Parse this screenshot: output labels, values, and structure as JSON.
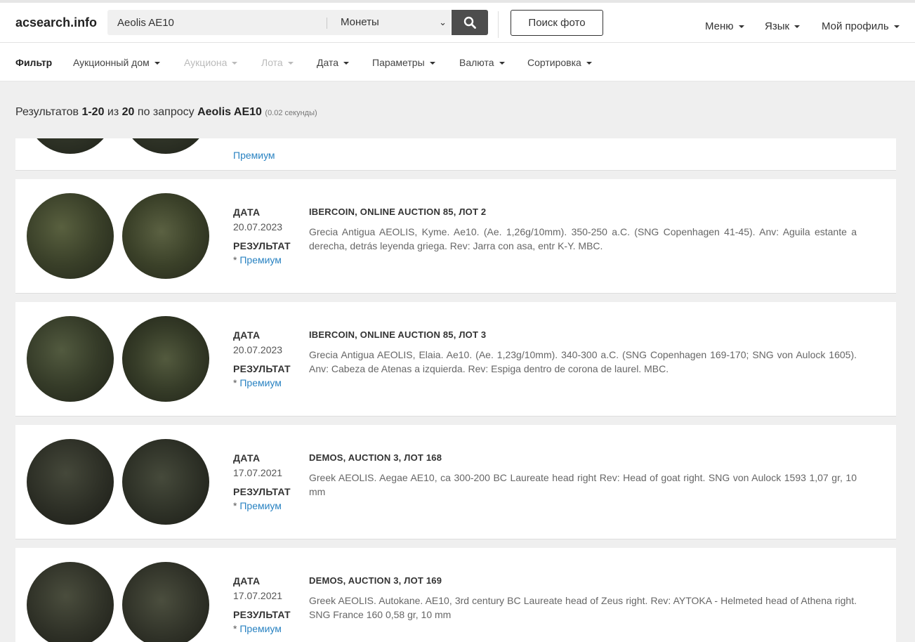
{
  "header": {
    "logo": "acsearch.info",
    "search_value": "Aeolis AE10",
    "category": "Монеты",
    "photo_search": "Поиск фото",
    "menu": "Меню",
    "language": "Язык",
    "profile": "Мой профиль"
  },
  "filters": {
    "title": "Фильтр",
    "auction_house": "Аукционный дом",
    "auctions": "Аукциона",
    "lots": "Лота",
    "date": "Дата",
    "params": "Параметры",
    "currency": "Валюта",
    "sort": "Сортировка"
  },
  "summary": {
    "prefix": "Результатов",
    "range": "1-20",
    "of": "из",
    "total": "20",
    "query_prefix": "по запросу",
    "query": "Aeolis AE10",
    "time": "(0.02 секунды)"
  },
  "labels": {
    "date": "ДАТА",
    "result": "РЕЗУЛЬТАТ",
    "premium_star": "*",
    "premium": "Премиум"
  },
  "results": [
    {
      "title": "IBERCOIN, ONLINE AUCTION 85, ЛОТ 2",
      "date": "20.07.2023",
      "description": "Grecia Antigua AEOLIS, Kyme. Ae10. (Ae. 1,26g/10mm). 350-250 a.C. (SNG Copenhagen 41-45). Anv: Aguila estante a derecha, detrás leyenda griega. Rev: Jarra con asa, entr K-Y. MBC."
    },
    {
      "title": "IBERCOIN, ONLINE AUCTION 85, ЛОТ 3",
      "date": "20.07.2023",
      "description": "Grecia Antigua AEOLIS, Elaia. Ae10. (Ae. 1,23g/10mm). 340-300 a.C. (SNG Copenhagen 169-170; SNG von Aulock 1605). Anv: Cabeza de Atenas a izquierda. Rev: Espiga dentro de corona de laurel. MBC."
    },
    {
      "title": "DEMOS, AUCTION 3, ЛОТ 168",
      "date": "17.07.2021",
      "description": "Greek AEOLIS. Aegae AE10, ca 300-200 BC Laureate head right Rev: Head of goat right. SNG von Aulock 1593 1,07 gr, 10 mm"
    },
    {
      "title": "DEMOS, AUCTION 3, ЛОТ 169",
      "date": "17.07.2021",
      "description": "Greek AEOLIS. Autokane. AE10, 3rd century BC Laureate head of Zeus right. Rev: AYTOKA - Helmeted head of Athena right. SNG France 160 0,58 gr, 10 mm"
    }
  ]
}
